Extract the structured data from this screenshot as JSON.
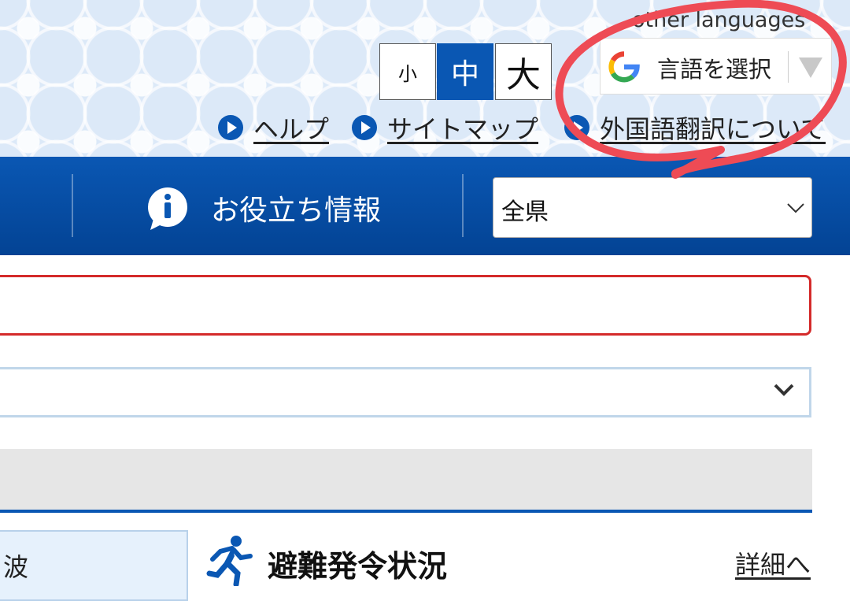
{
  "header": {
    "other_languages": "other languages",
    "font_size": {
      "small": "小",
      "medium": "中",
      "large": "大",
      "selected": "中"
    },
    "language_select": {
      "label": "言語を選択",
      "icon": "google-g-icon"
    },
    "links": [
      {
        "label": "ヘルプ",
        "icon": "play-circle-icon"
      },
      {
        "label": "サイトマップ",
        "icon": "play-circle-icon"
      },
      {
        "label": "外国語翻訳について",
        "icon": "play-circle-icon"
      }
    ]
  },
  "navbar": {
    "info_label": "お役立ち情報",
    "info_icon": "info-bubble-icon",
    "prefecture_select": {
      "value": "全県"
    }
  },
  "content": {
    "left_card_text": "波",
    "evacuation": {
      "title": "避難発令状況",
      "icon": "running-person-icon",
      "detail_link": "詳細へ"
    }
  },
  "colors": {
    "brand_blue": "#0a57b3",
    "alert_red": "#d42a2a",
    "annotation_red": "#ee4b55"
  }
}
